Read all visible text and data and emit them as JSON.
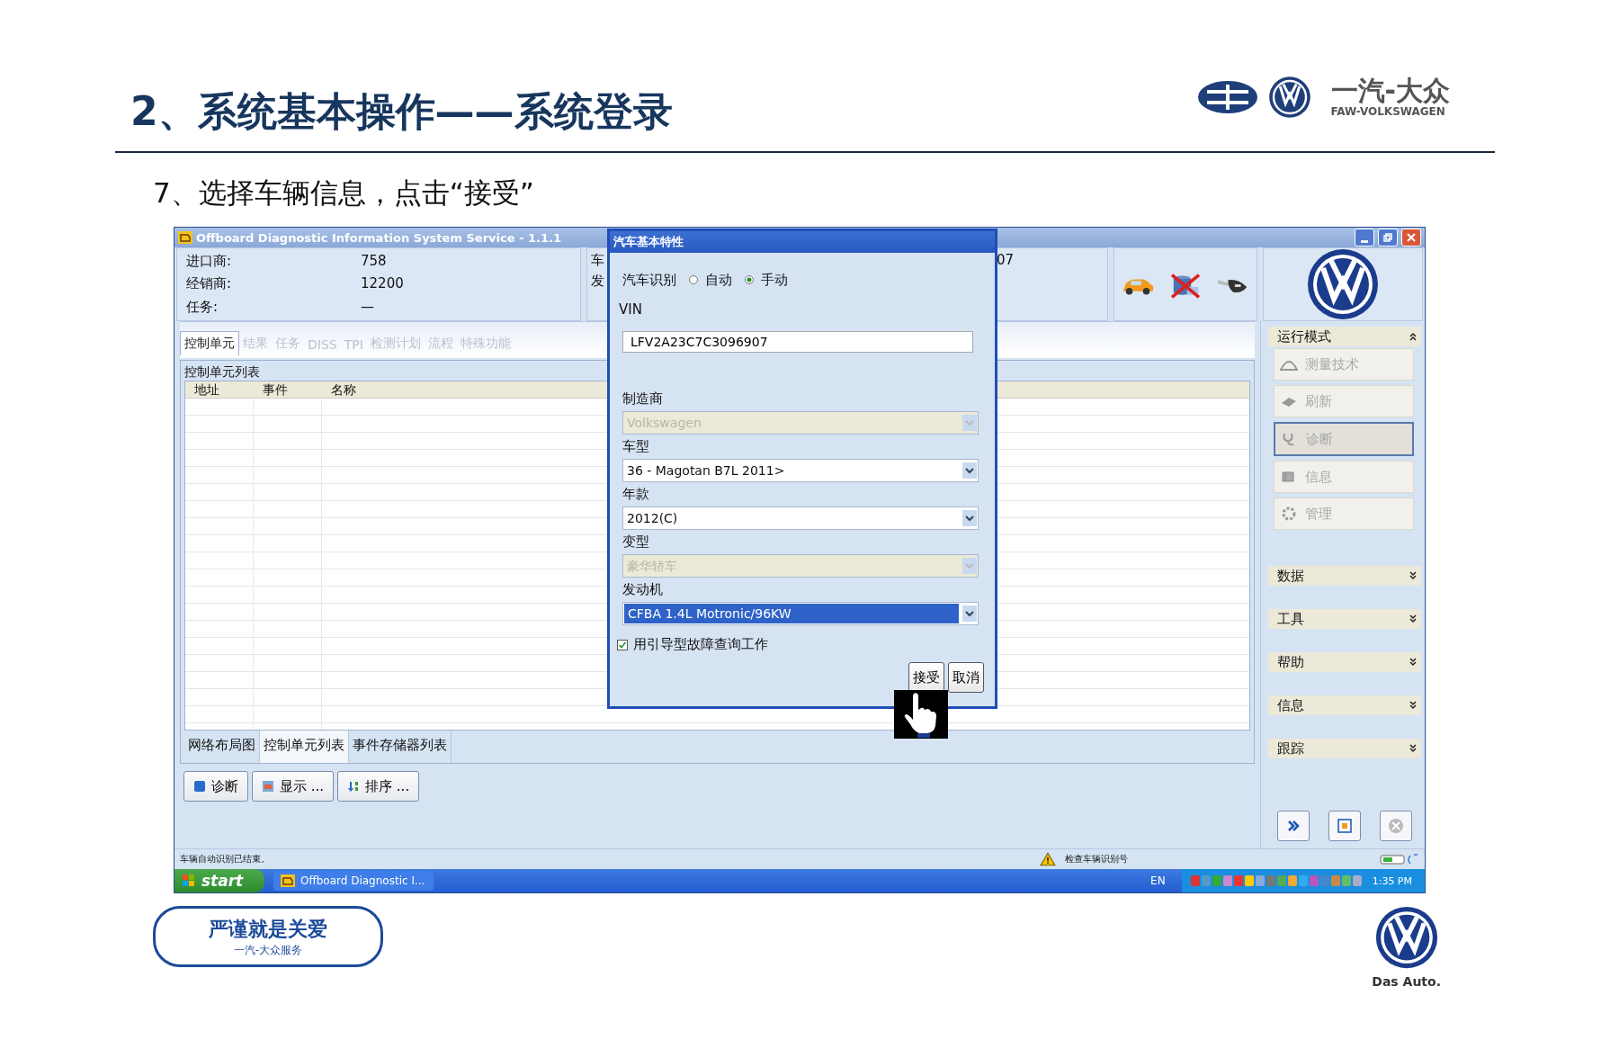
{
  "slide": {
    "title": "2、系统基本操作——系统登录",
    "brand_cn": "一汽-大众",
    "brand_en": "FAW-VOLKSWAGEN",
    "step": "7、选择车辆信息，点击“接受”"
  },
  "window": {
    "title": "Offboard Diagnostic Information System Service - 1.1.1",
    "info": [
      {
        "label": "进口商:",
        "value": "758"
      },
      {
        "label": "经销商:",
        "value": "12200"
      },
      {
        "label": "任务:",
        "value": "—"
      }
    ],
    "info_2_labels": [
      "车",
      "发"
    ],
    "info_2_value": "07",
    "tabs": [
      {
        "label": "控制单元",
        "selected": true,
        "disabled": false
      },
      {
        "label": "结果",
        "selected": false,
        "disabled": true
      },
      {
        "label": "任务",
        "selected": false,
        "disabled": true
      },
      {
        "label": "DISS",
        "selected": false,
        "disabled": true
      },
      {
        "label": "TPI",
        "selected": false,
        "disabled": true
      },
      {
        "label": "检测计划",
        "selected": false,
        "disabled": true
      },
      {
        "label": "流程",
        "selected": false,
        "disabled": true
      },
      {
        "label": "特殊功能",
        "selected": false,
        "disabled": true
      }
    ],
    "panel_title": "控制单元列表",
    "columns": [
      "地址",
      "事件",
      "名称"
    ],
    "bottom_tabs": [
      {
        "label": "网络布局图",
        "selected": false
      },
      {
        "label": "控制单元列表",
        "selected": true
      },
      {
        "label": "事件存储器列表",
        "selected": false
      }
    ],
    "actions": [
      "诊断",
      "显示 ...",
      "排序 ..."
    ],
    "sidebar": [
      {
        "label": "运行模式",
        "expanded": true,
        "items": [
          {
            "label": "测量技术",
            "selected": false,
            "disabled": true
          },
          {
            "label": "刷新",
            "selected": false,
            "disabled": true
          },
          {
            "label": "诊断",
            "selected": true,
            "disabled": true
          },
          {
            "label": "信息",
            "selected": false,
            "disabled": true
          },
          {
            "label": "管理",
            "selected": false,
            "disabled": true
          }
        ]
      },
      {
        "label": "数据",
        "expanded": false
      },
      {
        "label": "工具",
        "expanded": false
      },
      {
        "label": "帮助",
        "expanded": false
      },
      {
        "label": "信息",
        "expanded": false
      },
      {
        "label": "跟踪",
        "expanded": false
      }
    ],
    "status": {
      "left": "车辆自动识别已结束。",
      "right": "检查车辆识别号"
    },
    "taskbar": {
      "start": "start",
      "task": "Offboard Diagnostic I...",
      "lang": "EN",
      "clock": "1:35 PM"
    }
  },
  "dialog": {
    "title": "汽车基本特性",
    "identify_label": "汽车识别",
    "modes": [
      {
        "label": "自动",
        "selected": false
      },
      {
        "label": "手动",
        "selected": true
      }
    ],
    "vin_label": "VIN",
    "vin": "LFV2A23C7C3096907",
    "fields": [
      {
        "label": "制造商",
        "value": "Volkswagen",
        "disabled": true,
        "highlighted": false
      },
      {
        "label": "车型",
        "value": "36 - Magotan B7L 2011>",
        "disabled": false,
        "highlighted": false
      },
      {
        "label": "年款",
        "value": "2012(C)",
        "disabled": false,
        "highlighted": false
      },
      {
        "label": "变型",
        "value": "豪华轿车",
        "disabled": true,
        "highlighted": false
      },
      {
        "label": "发动机",
        "value": "CFBA 1.4L Motronic/96KW",
        "disabled": false,
        "highlighted": true
      }
    ],
    "checkbox": {
      "label": "用引导型故障查询工作",
      "checked": true
    },
    "buttons": [
      "接受",
      "取消"
    ]
  },
  "footer": {
    "motto": "严谨就是关爱",
    "service": "一汽-大众服务",
    "slogan": "Das Auto."
  }
}
